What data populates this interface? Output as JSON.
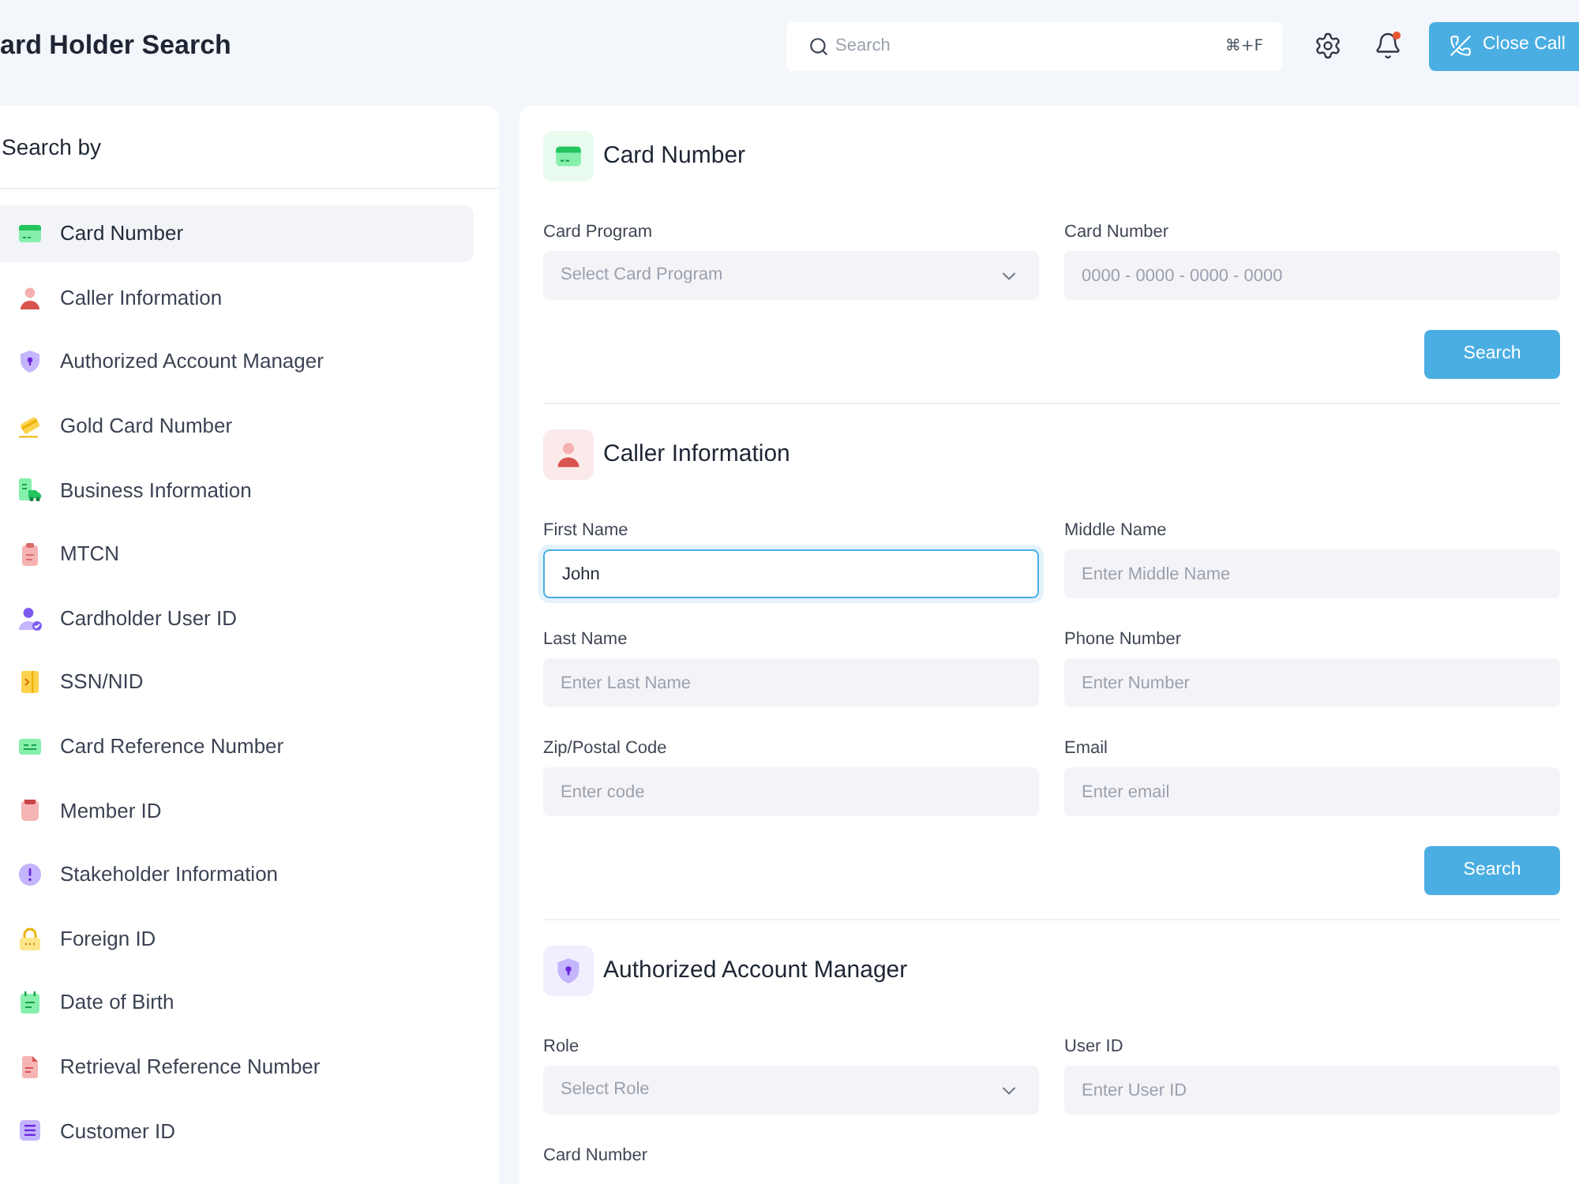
{
  "header": {
    "title": "ard Holder Search",
    "search": {
      "placeholder": "Search",
      "shortcut": "⌘+F"
    },
    "notification_dot": true,
    "close_call": "Close Call"
  },
  "sidebar": {
    "title": "Search by",
    "items": [
      {
        "label": "Card Number",
        "selected": true
      },
      {
        "label": "Caller Information",
        "selected": false
      },
      {
        "label": "Authorized Account Manager",
        "selected": false
      },
      {
        "label": "Gold Card Number",
        "selected": false
      },
      {
        "label": "Business Information",
        "selected": false
      },
      {
        "label": "MTCN",
        "selected": false
      },
      {
        "label": "Cardholder User ID",
        "selected": false
      },
      {
        "label": "SSN/NID",
        "selected": false
      },
      {
        "label": "Card Reference Number",
        "selected": false
      },
      {
        "label": "Member ID",
        "selected": false
      },
      {
        "label": "Stakeholder Information",
        "selected": false
      },
      {
        "label": "Foreign ID",
        "selected": false
      },
      {
        "label": "Date of Birth",
        "selected": false
      },
      {
        "label": "Retrieval Reference Number",
        "selected": false
      },
      {
        "label": "Customer ID",
        "selected": false
      }
    ]
  },
  "sections": [
    {
      "title": "Card Number",
      "fields": [
        {
          "kind": "select",
          "label": "Card Program",
          "placeholder": "Select Card Program",
          "focused": false
        },
        {
          "kind": "input",
          "label": "Card Number",
          "placeholder": "0000 - 0000 - 0000 - 0000",
          "focused": false
        }
      ],
      "button": "Search"
    },
    {
      "title": "Caller Information",
      "fields": [
        {
          "kind": "input",
          "label": "First Name",
          "value": "John",
          "focused": true
        },
        {
          "kind": "input",
          "label": "Middle Name",
          "placeholder": "Enter Middle Name",
          "focused": false
        },
        {
          "kind": "input",
          "label": "Last Name",
          "placeholder": "Enter Last Name",
          "focused": false
        },
        {
          "kind": "input",
          "label": "Phone Number",
          "placeholder": "Enter Number",
          "focused": false
        },
        {
          "kind": "input",
          "label": "Zip/Postal Code",
          "placeholder": "Enter code",
          "focused": false
        },
        {
          "kind": "input",
          "label": "Email",
          "placeholder": "Enter email",
          "focused": false
        }
      ],
      "button": "Search"
    },
    {
      "title": "Authorized Account Manager",
      "fields": [
        {
          "kind": "select",
          "label": "Role",
          "placeholder": "Select Role",
          "focused": false
        },
        {
          "kind": "input",
          "label": "User ID",
          "placeholder": "Enter User ID",
          "focused": false
        },
        {
          "kind": "label",
          "label": "Card Number"
        }
      ]
    }
  ]
}
